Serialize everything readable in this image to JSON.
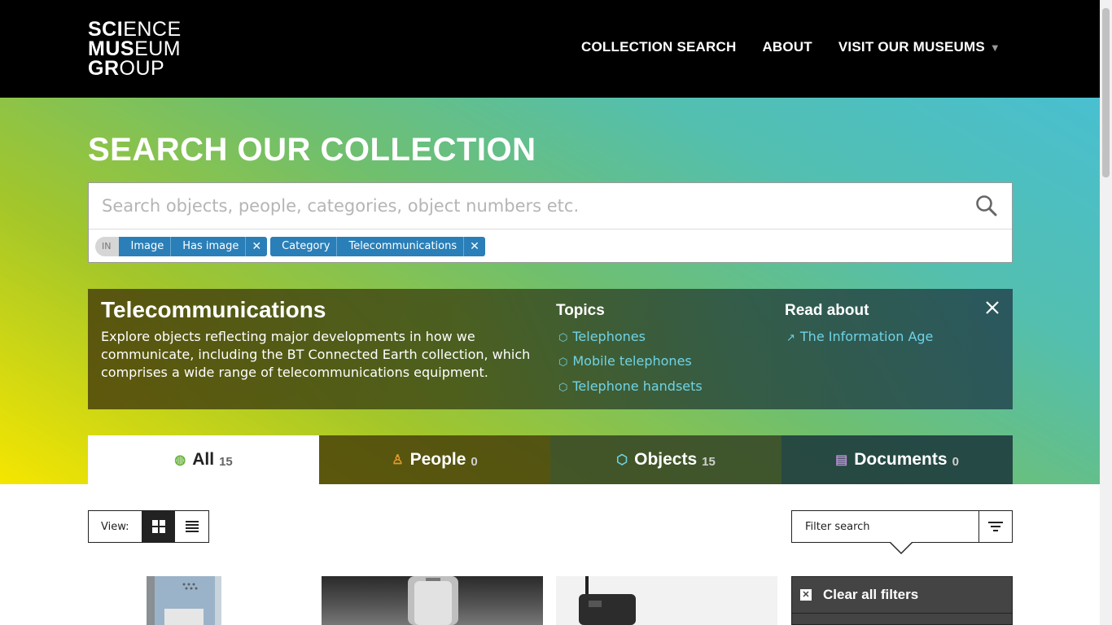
{
  "header": {
    "logo_lines": [
      "SCIENCE",
      "MUSEUM",
      "GROUP"
    ],
    "nav": [
      {
        "label": "COLLECTION SEARCH"
      },
      {
        "label": "ABOUT"
      },
      {
        "label": "VISIT OUR MUSEUMS"
      }
    ],
    "nav_caret": "▼"
  },
  "hero": {
    "title": "SEARCH OUR COLLECTION"
  },
  "search": {
    "placeholder": "Search objects, people, categories, object numbers etc.",
    "value": "",
    "in_label": "IN",
    "filters": [
      {
        "segments": [
          "Image",
          "Has image"
        ],
        "remove": "✕"
      },
      {
        "segments": [
          "Category",
          "Telecommunications"
        ],
        "remove": "✕"
      }
    ]
  },
  "info_panel": {
    "title": "Telecommunications",
    "description": "Explore objects reflecting major developments in how we communicate, including the BT Connected Earth collection, which comprises a wide range of telecommunications equipment.",
    "topics_heading": "Topics",
    "topics": [
      "Telephones",
      "Mobile telephones",
      "Telephone handsets"
    ],
    "read_heading": "Read about",
    "read_links": [
      "The Information Age"
    ]
  },
  "tabs": [
    {
      "label": "All",
      "count": "15",
      "icon": "globe-icon"
    },
    {
      "label": "People",
      "count": "0",
      "icon": "person-icon"
    },
    {
      "label": "Objects",
      "count": "15",
      "icon": "cube-icon"
    },
    {
      "label": "Documents",
      "count": "0",
      "icon": "document-icon"
    }
  ],
  "results_bar": {
    "view_label": "View:",
    "filter_placeholder": "Filter search"
  },
  "filters_panel": {
    "clear_all": "Clear all filters"
  },
  "colors": {
    "header_bg": "#000000",
    "chip_blue": "#2a7fb8",
    "link_cyan": "#6fd3e6",
    "tab_active_bg": "#ffffff"
  }
}
